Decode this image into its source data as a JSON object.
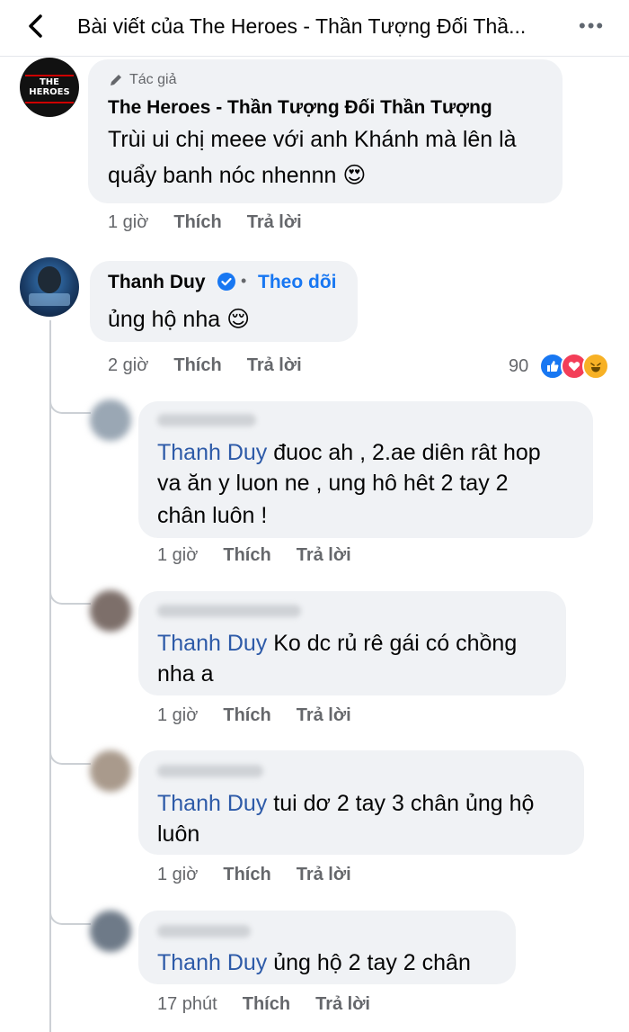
{
  "header": {
    "title": "Bài viết của The Heroes - Thần Tượng Đối Thầ...",
    "back_icon": "chevron-left-icon",
    "more_icon": "more-horizontal-icon"
  },
  "comments": [
    {
      "author_badge": "Tác giả",
      "avatar_text": "THE HEROES",
      "name": "The Heroes - Thần Tượng Đối Thần Tượng",
      "text_line1": "Trùi ui chị meee với anh Khánh mà lên là",
      "text_line2": "quẩy banh nóc nhennn 😍",
      "time": "1 giờ",
      "like": "Thích",
      "reply": "Trả lời"
    },
    {
      "name": "Thanh Duy",
      "follow": "Theo dõi",
      "separator": "•",
      "text": "ủng hộ nha 😌",
      "time": "2 giờ",
      "like": "Thích",
      "reply": "Trả lời",
      "reaction_count": "90",
      "reactions": [
        "like-icon",
        "love-icon",
        "haha-icon"
      ]
    }
  ],
  "replies": [
    {
      "mention": "Thanh Duy",
      "line1": " đuoc ah , 2.ae diên rât hop",
      "line2": "va ăn y luon ne , ung hô hêt  2 tay 2",
      "line3": "chân luôn !",
      "time": "1 giờ",
      "like": "Thích",
      "reply": "Trả lời"
    },
    {
      "mention": "Thanh Duy",
      "line1": " Ko dc rủ rê gái có chồng",
      "line2": "nha a",
      "time": "1 giờ",
      "like": "Thích",
      "reply": "Trả lời"
    },
    {
      "mention": "Thanh Duy",
      "line1": " tui dơ 2 tay 3 chân ủng hộ",
      "line2": "luôn",
      "time": "1 giờ",
      "like": "Thích",
      "reply": "Trả lời"
    },
    {
      "mention": "Thanh Duy",
      "line1": " ủng hộ 2 tay 2 chân",
      "time": "17 phút",
      "like": "Thích",
      "reply": "Trả lời"
    }
  ],
  "colors": {
    "mention": "#2d5aa8",
    "bubble": "#f0f2f5",
    "meta": "#65676b",
    "verified": "#1877f2"
  }
}
